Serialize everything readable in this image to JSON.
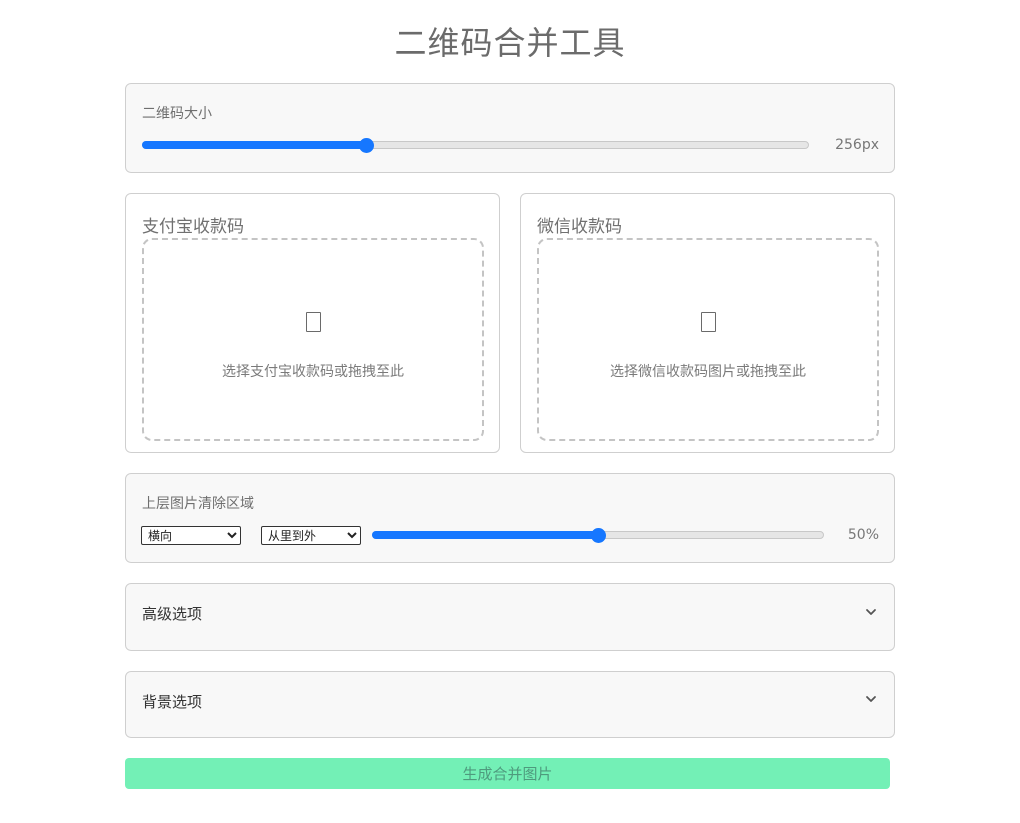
{
  "page": {
    "title": "二维码合并工具"
  },
  "size_panel": {
    "label": "二维码大小",
    "value_text": "256px",
    "slider_fraction": 0.335
  },
  "alipay": {
    "title": "支付宝收款码",
    "dropzone_text": "选择支付宝收款码或拖拽至此",
    "icon": "image-file-icon"
  },
  "wechat": {
    "title": "微信收款码",
    "dropzone_text": "选择微信收款码图片或拖拽至此",
    "icon": "image-file-icon"
  },
  "clear_panel": {
    "label": "上层图片清除区域",
    "direction_selected": "横向",
    "order_selected": "从里到外",
    "value_text": "50%",
    "slider_fraction": 0.5
  },
  "advanced": {
    "label": "高级选项",
    "icon": "chevron-down-icon"
  },
  "background": {
    "label": "背景选项",
    "icon": "chevron-down-icon"
  },
  "submit": {
    "label": "生成合并图片"
  },
  "colors": {
    "accent": "#1677ff",
    "submit_bg": "#73f0b6",
    "panel_bg": "#f8f8f8"
  }
}
